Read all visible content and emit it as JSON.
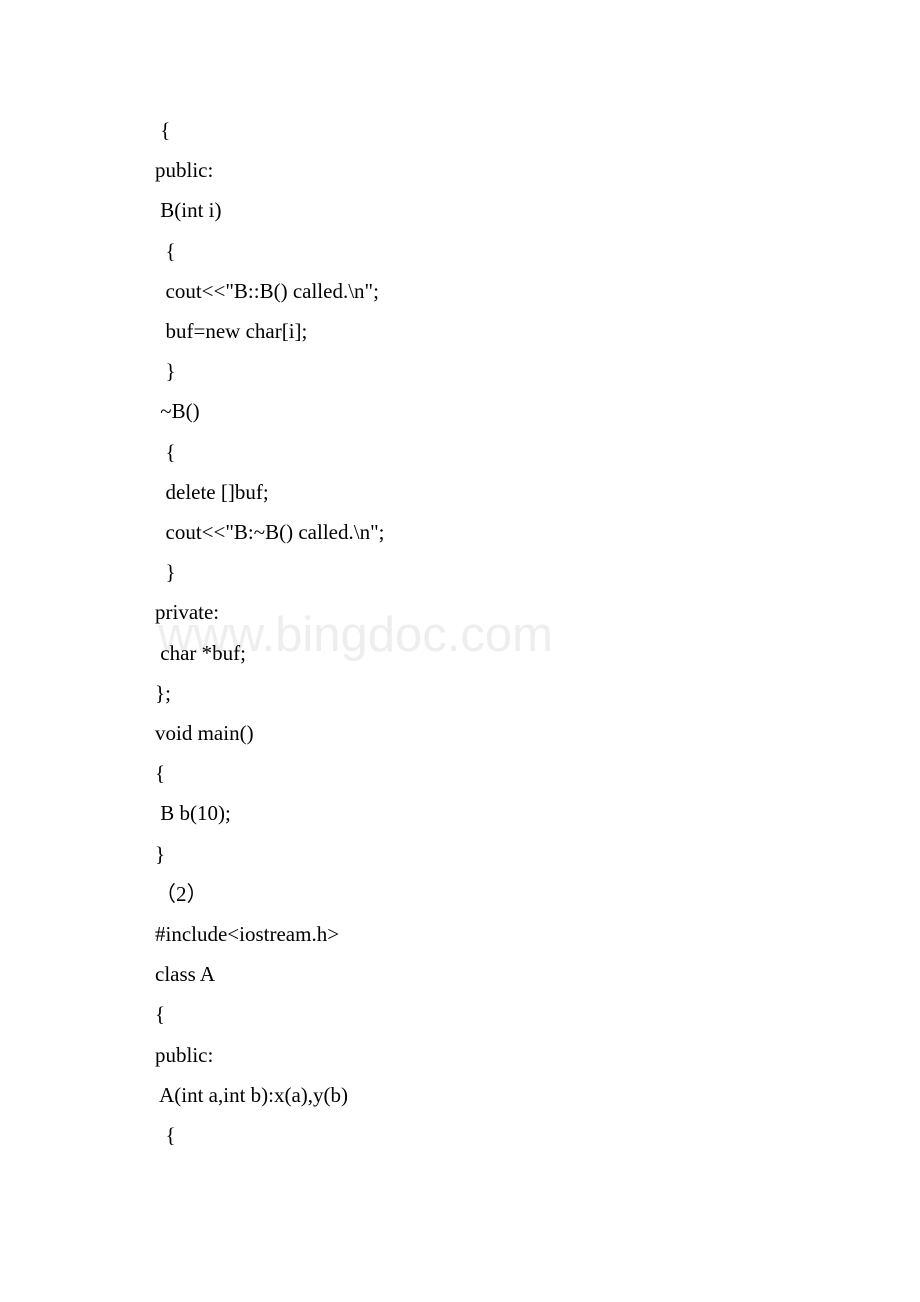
{
  "watermark": "www.bingdoc.com",
  "code": {
    "l1": " {",
    "l2": "public:",
    "l3": " B(int i)",
    "l4": "  {",
    "l5": "  cout<<\"B::B() called.\\n\";",
    "l6": "  buf=new char[i];",
    "l7": "  }",
    "l8": " ~B()",
    "l9": "  {",
    "l10": "  delete []buf;",
    "l11": "  cout<<\"B:~B() called.\\n\";",
    "l12": "  }",
    "l13": "private:",
    "l14": " char *buf;",
    "l15": "};",
    "l16": "void main()",
    "l17": "{",
    "l18": " B b(10);",
    "l19": "}",
    "l20": "（2）",
    "l21": "#include<iostream.h>",
    "l22": "class A",
    "l23": "{",
    "l24": "public:",
    "l25": " A(int a,int b):x(a),y(b)",
    "l26": "  {"
  }
}
